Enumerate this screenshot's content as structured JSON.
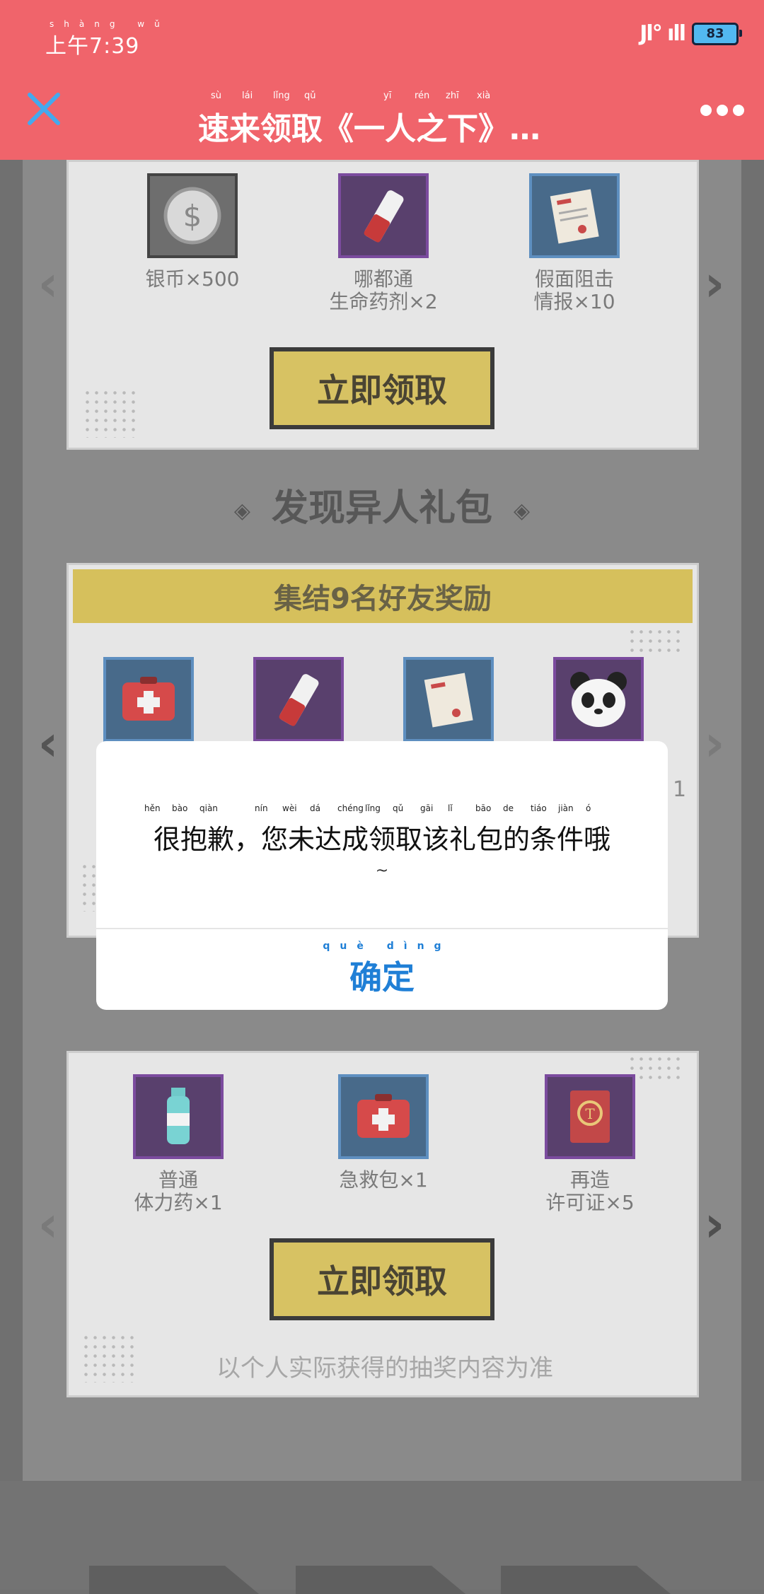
{
  "status_bar": {
    "time_pinyin": "shàng wǔ",
    "time": "上午7:39",
    "signal": "Jl° ıll",
    "battery": "83"
  },
  "nav": {
    "close_icon": "close-icon",
    "title_pinyin": [
      "sù",
      "lái",
      "lǐng",
      "qǔ",
      "yī",
      "rén",
      "zhī",
      "xià"
    ],
    "title": "速来领取《一人之下》…",
    "more_icon": "more-dots-icon"
  },
  "gift_panel_1": {
    "items": [
      {
        "name": "银币×500",
        "icon": "silver-coin-icon"
      },
      {
        "line1": "哪都通",
        "line2": "生命药剂×2",
        "icon": "potion-vial-icon"
      },
      {
        "line1": "假面阻击",
        "line2": "情报×10",
        "icon": "intel-document-icon"
      }
    ],
    "claim_label": "立即领取"
  },
  "section_heading": "发现异人礼包",
  "gift_panel_2": {
    "banner": "集结9名好友奖励",
    "partial_text": "1",
    "items": [
      {
        "icon": "first-aid-kit-icon"
      },
      {
        "icon": "potion-vial-icon"
      },
      {
        "icon": "intel-document-icon"
      },
      {
        "icon": "panda-icon"
      }
    ]
  },
  "gift_panel_3": {
    "items": [
      {
        "line1": "普通",
        "line2": "体力药×1",
        "icon": "stamina-drink-icon"
      },
      {
        "name": "急救包×1",
        "icon": "first-aid-kit-icon"
      },
      {
        "line1": "再造",
        "line2": "许可证×5",
        "icon": "permit-book-icon"
      }
    ],
    "claim_label": "立即领取",
    "footer_note": "以个人实际获得的抽奖内容为准"
  },
  "dialog": {
    "message_pinyin": [
      "hěn",
      "bào",
      "qiàn",
      "nín",
      "wèi",
      "dá",
      "chéng",
      "lǐng",
      "qǔ",
      "gāi",
      "lǐ",
      "bāo",
      "de",
      "tiáo",
      "jiàn",
      "ó"
    ],
    "message": "很抱歉，您未达成领取该礼包的条件哦",
    "tilde": "~",
    "confirm_pinyin": "què dìng",
    "confirm_label": "确定"
  },
  "colors": {
    "header": "#f0646b",
    "accent_blue": "#1f7fd6",
    "claim_button": "#d7c263"
  }
}
